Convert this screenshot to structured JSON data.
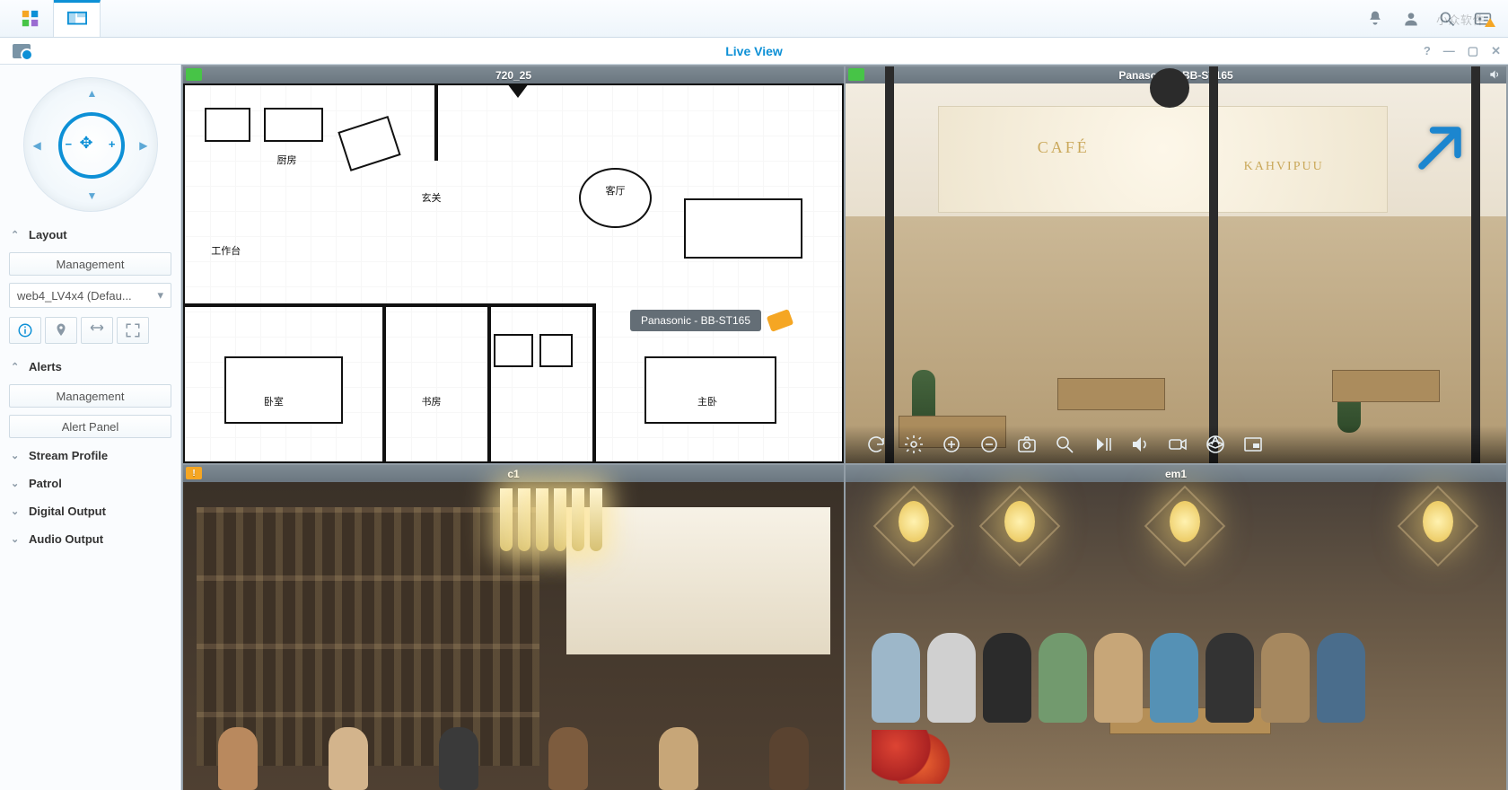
{
  "topbar": {
    "watermark": "小众软件"
  },
  "window": {
    "title": "Live View"
  },
  "sidebar": {
    "sections": {
      "layout": {
        "label": "Layout",
        "management_label": "Management",
        "select_value": "web4_LV4x4 (Defau..."
      },
      "alerts": {
        "label": "Alerts",
        "management_label": "Management",
        "panel_label": "Alert Panel"
      },
      "stream_profile": {
        "label": "Stream Profile"
      },
      "patrol": {
        "label": "Patrol"
      },
      "digital_output": {
        "label": "Digital Output"
      },
      "audio_output": {
        "label": "Audio Output"
      }
    }
  },
  "tiles": {
    "floorplan": {
      "title": "720_25",
      "camera_tag": "Panasonic - BB-ST165",
      "room_labels": [
        "厨房",
        "玄关",
        "客厅",
        "卧室",
        "主卧",
        "书房",
        "工作台"
      ]
    },
    "cafe": {
      "title": "Panasonic - BB-ST165",
      "window_text_left": "CAFÉ",
      "window_text_right": "KAHVIPUU"
    },
    "c1": {
      "title": "c1"
    },
    "em1": {
      "title": "em1"
    }
  }
}
